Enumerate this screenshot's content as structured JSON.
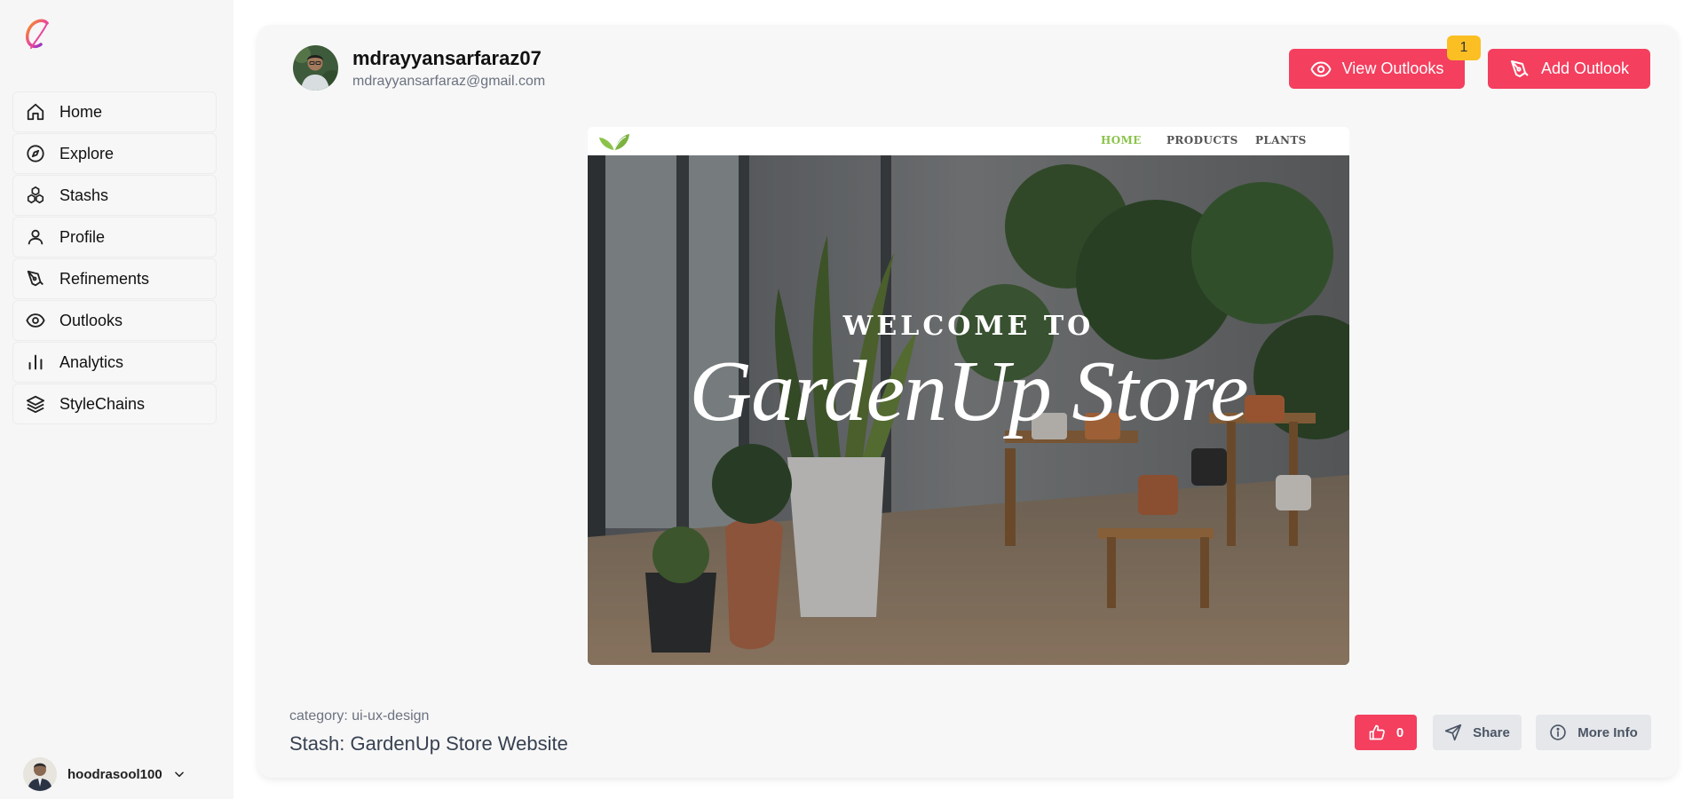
{
  "sidebar": {
    "logo_letter": "C",
    "items": [
      {
        "label": "Home",
        "icon": "home-icon"
      },
      {
        "label": "Explore",
        "icon": "compass-icon"
      },
      {
        "label": "Stashs",
        "icon": "cubes-icon"
      },
      {
        "label": "Profile",
        "icon": "user-icon"
      },
      {
        "label": "Refinements",
        "icon": "pen-nib-icon"
      },
      {
        "label": "Outlooks",
        "icon": "eye-icon"
      },
      {
        "label": "Analytics",
        "icon": "bar-chart-icon"
      },
      {
        "label": "StyleChains",
        "icon": "layers-icon"
      }
    ],
    "current_user": "hoodrasool100"
  },
  "stash": {
    "owner_username": "mdrayyansarfaraz07",
    "owner_email": "mdrayyansarfaraz@gmail.com",
    "view_outlooks_label": "View Outlooks",
    "outlooks_count": "1",
    "add_outlook_label": "Add Outlook",
    "category": "category: ui-ux-design",
    "title": "Stash: GardenUp Store Website",
    "likes": "0",
    "share_label": "Share",
    "more_info_label": "More Info"
  },
  "preview": {
    "nav_links": [
      "HOME",
      "PRODUCTS",
      "PLANTS"
    ],
    "welcome": "WELCOME TO",
    "title": "GardenUp Store"
  },
  "colors": {
    "accent": "#f43f5e",
    "badge": "#fbbf24",
    "preview_active_link": "#8bc34a"
  }
}
